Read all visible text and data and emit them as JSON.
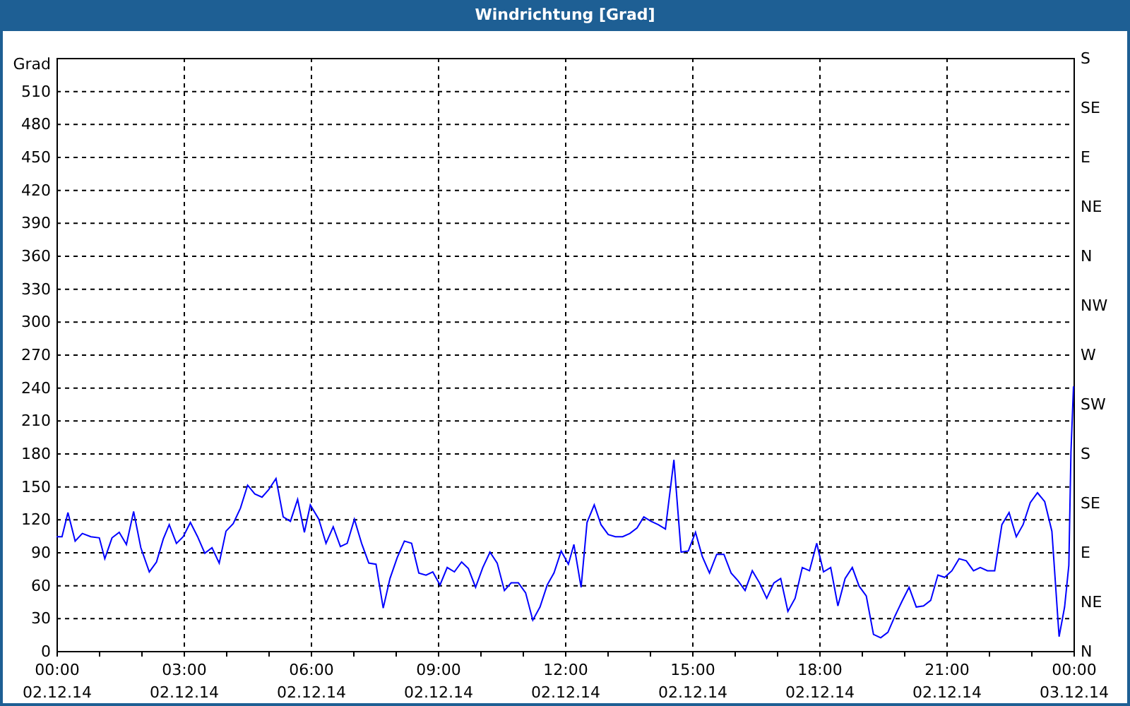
{
  "window": {
    "title": "Windrichtung [Grad]"
  },
  "chart": {
    "x_dates": [
      "02.12.14",
      "02.12.14",
      "02.12.14",
      "02.12.14",
      "02.12.14",
      "02.12.14",
      "02.12.14",
      "02.12.14",
      "03.12.14"
    ],
    "compass_labels": [
      "S",
      "SE",
      "E",
      "NE",
      "N",
      "NW",
      "W",
      "SW",
      "S",
      "SE",
      "E",
      "NE",
      "N"
    ],
    "chart_data": {
      "type": "line",
      "grid": true,
      "ylabel": "Grad",
      "xlim": [
        0,
        24
      ],
      "ylim": [
        0,
        540
      ],
      "xticks": [
        {
          "value": 0,
          "label": "00:00"
        },
        {
          "value": 3,
          "label": "03:00"
        },
        {
          "value": 6,
          "label": "06:00"
        },
        {
          "value": 9,
          "label": "09:00"
        },
        {
          "value": 12,
          "label": "12:00"
        },
        {
          "value": 15,
          "label": "15:00"
        },
        {
          "value": 18,
          "label": "18:00"
        },
        {
          "value": 21,
          "label": "21:00"
        },
        {
          "value": 24,
          "label": "00:00"
        }
      ],
      "yticks": [
        0,
        30,
        60,
        90,
        120,
        150,
        180,
        210,
        240,
        270,
        300,
        330,
        360,
        390,
        420,
        450,
        480,
        510
      ],
      "x": [
        0,
        0.13,
        0.27,
        0.44,
        0.61,
        0.81,
        1.01,
        1.14,
        1.31,
        1.48,
        1.65,
        1.82,
        1.99,
        2.19,
        2.36,
        2.52,
        2.66,
        2.83,
        2.99,
        3.16,
        3.33,
        3.5,
        3.67,
        3.84,
        4.0,
        4.17,
        4.34,
        4.51,
        4.68,
        4.85,
        5.01,
        5.18,
        5.35,
        5.52,
        5.69,
        5.85,
        5.99,
        6.19,
        6.36,
        6.53,
        6.7,
        6.86,
        7.03,
        7.2,
        7.37,
        7.54,
        7.71,
        7.87,
        8.04,
        8.21,
        8.38,
        8.55,
        8.72,
        8.88,
        9.05,
        9.22,
        9.39,
        9.56,
        9.72,
        9.89,
        10.06,
        10.23,
        10.4,
        10.57,
        10.73,
        10.9,
        11.07,
        11.24,
        11.41,
        11.58,
        11.74,
        11.91,
        12.08,
        12.21,
        12.38,
        12.52,
        12.69,
        12.85,
        13.02,
        13.19,
        13.36,
        13.53,
        13.7,
        13.86,
        14.03,
        14.2,
        14.37,
        14.57,
        14.74,
        14.91,
        15.08,
        15.24,
        15.41,
        15.58,
        15.75,
        15.92,
        16.08,
        16.25,
        16.42,
        16.59,
        16.76,
        16.93,
        17.09,
        17.26,
        17.43,
        17.6,
        17.77,
        17.94,
        18.1,
        18.27,
        18.44,
        18.61,
        18.78,
        18.94,
        19.11,
        19.28,
        19.45,
        19.62,
        19.79,
        19.95,
        20.12,
        20.29,
        20.46,
        20.63,
        20.8,
        20.96,
        21.13,
        21.3,
        21.47,
        21.64,
        21.8,
        21.97,
        22.14,
        22.31,
        22.48,
        22.65,
        22.81,
        22.98,
        23.15,
        23.32,
        23.49,
        23.66,
        23.79,
        23.89,
        23.94,
        24.0
      ],
      "series": [
        {
          "color": "#0000ff",
          "values": [
            104,
            104,
            126,
            100,
            107,
            104,
            103,
            84,
            103,
            108,
            97,
            127,
            94,
            72,
            81,
            102,
            115,
            98,
            104,
            117,
            104,
            89,
            94,
            80,
            109,
            116,
            130,
            151,
            143,
            140,
            147,
            157,
            122,
            118,
            138,
            108,
            133,
            120,
            98,
            113,
            95,
            98,
            120,
            98,
            80,
            79,
            39,
            66,
            85,
            100,
            98,
            71,
            69,
            72,
            60,
            76,
            72,
            81,
            75,
            58,
            76,
            90,
            80,
            55,
            62,
            62,
            53,
            28,
            40,
            60,
            71,
            91,
            79,
            97,
            58,
            117,
            133,
            115,
            106,
            104,
            104,
            107,
            112,
            122,
            118,
            115,
            111,
            174,
            90,
            91,
            108,
            86,
            71,
            88,
            88,
            71,
            64,
            55,
            73,
            62,
            48,
            62,
            66,
            36,
            48,
            76,
            73,
            98,
            72,
            76,
            41,
            66,
            76,
            59,
            50,
            15,
            12,
            17,
            32,
            45,
            58,
            40,
            41,
            46,
            69,
            67,
            73,
            84,
            82,
            73,
            76,
            73,
            73,
            115,
            126,
            104,
            115,
            135,
            144,
            136,
            109,
            13,
            40,
            78,
            181,
            241
          ]
        }
      ]
    }
  }
}
